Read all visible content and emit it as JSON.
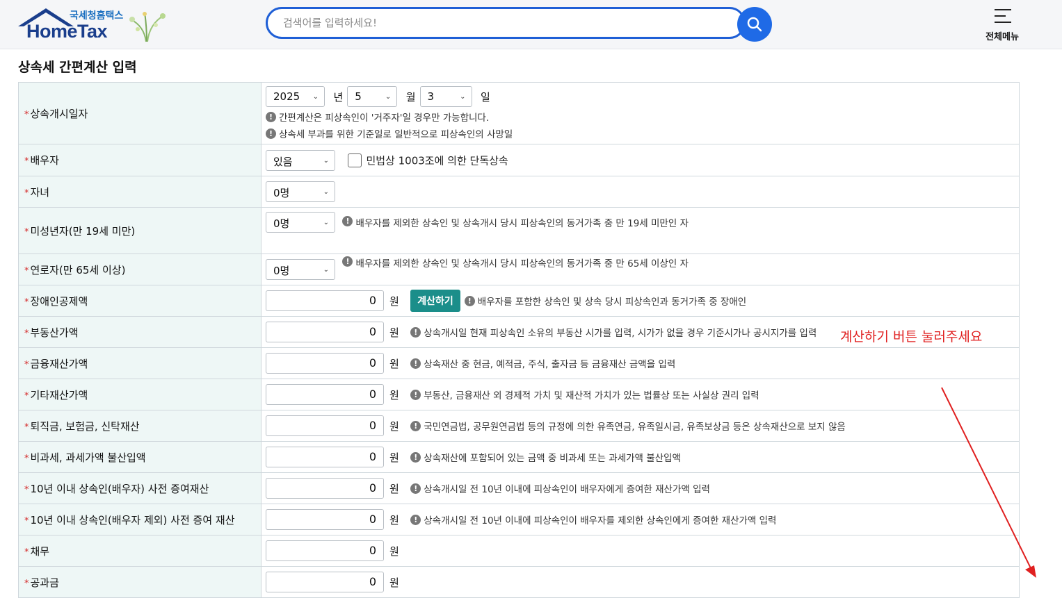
{
  "header": {
    "logo_sub": "국세청홈택스",
    "logo_main": "HomeTax",
    "search_placeholder": "검색어를 입력하세요!",
    "menu_label": "전체메뉴"
  },
  "page_title": "상속세 간편계산 입력",
  "rows": {
    "start_date": {
      "label": "상속개시일자",
      "year": "2025",
      "year_unit": "년",
      "month": "5",
      "month_unit": "월",
      "day": "3",
      "day_unit": "일",
      "note1": "간편계산은 피상속인이 '거주자'일 경우만 가능합니다.",
      "note2": "상속세 부과를 위한 기준일로 일반적으로 피상속인의 사망일"
    },
    "spouse": {
      "label": "배우자",
      "value": "있음",
      "checkbox_label": "민법상 1003조에 의한 단독상속"
    },
    "children": {
      "label": "자녀",
      "value": "0명"
    },
    "minors": {
      "label": "미성년자(만 19세 미만)",
      "value": "0명",
      "note": "배우자를 제외한 상속인 및 상속개시 당시 피상속인의 동거가족 중 만 19세 미만인 자"
    },
    "elderly": {
      "label": "연로자(만 65세 이상)",
      "value": "0명",
      "note": "배우자를 제외한 상속인 및 상속개시 당시 피상속인의 동거가족 중 만 65세 이상인 자"
    },
    "disabled": {
      "label": "장애인공제액",
      "value": "0",
      "unit": "원",
      "button": "계산하기",
      "note": "배우자를 포함한 상속인 및 상속 당시 피상속인과 동거가족 중 장애인"
    },
    "real_estate": {
      "label": "부동산가액",
      "value": "0",
      "unit": "원",
      "note": "상속개시일 현재 피상속인 소유의 부동산 시가를 입력, 시가가 없을 경우 기준시가나 공시지가를 입력"
    },
    "financial": {
      "label": "금융재산가액",
      "value": "0",
      "unit": "원",
      "note": "상속재산 중 현금, 예적금, 주식, 출자금 등 금융재산 금액을 입력"
    },
    "other": {
      "label": "기타재산가액",
      "value": "0",
      "unit": "원",
      "note": "부동산, 금융재산 외 경제적 가치 및 재산적 가치가 있는 법률상 또는 사실상 권리 입력"
    },
    "retirement": {
      "label": "퇴직금, 보험금, 신탁재산",
      "value": "0",
      "unit": "원",
      "note": "국민연금법, 공무원연금법 등의 규정에 의한 유족연금, 유족일시금, 유족보상금 등은 상속재산으로 보지 않음"
    },
    "nontax": {
      "label": "비과세, 과세가액 불산입액",
      "value": "0",
      "unit": "원",
      "note": "상속재산에 포함되어 있는 금액 중 비과세 또는 과세가액 불산입액"
    },
    "gift_spouse": {
      "label": "10년 이내 상속인(배우자) 사전 증여재산",
      "value": "0",
      "unit": "원",
      "note": "상속개시일 전 10년 이내에 피상속인이 배우자에게 증여한 재산가액 입력"
    },
    "gift_others": {
      "label": "10년 이내 상속인(배우자 제외) 사전 증여 재산",
      "value": "0",
      "unit": "원",
      "note": "상속개시일 전 10년 이내에 피상속인이 배우자를 제외한 상속인에게 증여한 재산가액 입력"
    },
    "debt": {
      "label": "채무",
      "value": "0",
      "unit": "원"
    },
    "dues": {
      "label": "공과금",
      "value": "0",
      "unit": "원"
    }
  },
  "annotation": "계산하기 버튼 눌러주세요",
  "colors": {
    "accent": "#1f6ae6",
    "button": "#1b8e8a",
    "annotation": "#e02020",
    "label_bg": "#eef7f6"
  }
}
